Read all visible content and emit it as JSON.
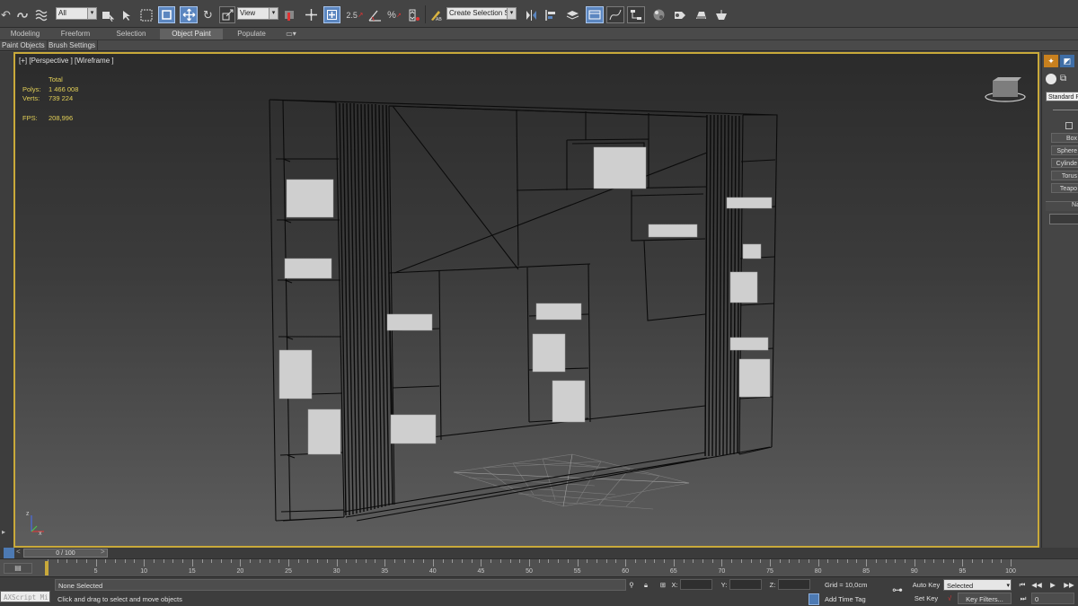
{
  "toolbar": {
    "selection_filter": "All",
    "ref_coord_system": "View",
    "named_selection": "Create Selection Se",
    "snap_angle_label": "2.5",
    "icons": [
      "undo-icon",
      "redo-icon",
      "link-icon",
      "unlink-icon",
      "bind-spacewarp-icon",
      "select-object-icon",
      "select-by-name-icon",
      "rect-selection-icon",
      "window-crossing-icon",
      "select-move-icon",
      "select-rotate-icon",
      "select-scale-icon",
      "pivot-icon",
      "manipulate-icon",
      "snap-toggle-icon",
      "angle-snap-icon",
      "percent-snap-icon",
      "spinner-snap-icon",
      "edit-named-selection-icon",
      "mirror-icon",
      "align-icon",
      "layer-explorer-icon",
      "scene-explorer-icon",
      "curve-editor-icon",
      "schematic-view-icon",
      "material-editor-icon",
      "render-setup-icon",
      "rendered-frame-icon",
      "render-icon"
    ]
  },
  "ribbon": {
    "tabs": [
      "Modeling",
      "Freeform",
      "Selection",
      "Object Paint",
      "Populate"
    ],
    "active_tab": "Object Paint",
    "sub_items": [
      "Paint Objects",
      "Brush Settings"
    ]
  },
  "viewport": {
    "label": "[+] [Perspective ] [Wireframe ]",
    "stats": {
      "total_label": "Total",
      "polys_label": "Polys:",
      "polys_value": "1 466 008",
      "verts_label": "Verts:",
      "verts_value": "739 224",
      "fps_label": "FPS:",
      "fps_value": "208,996"
    }
  },
  "command_panel": {
    "dropdown": "Standard P",
    "buttons": [
      "Box",
      "Sphere",
      "Cylinde",
      "Torus",
      "Teapo"
    ],
    "name_label": "Na"
  },
  "timeline": {
    "slider_label": "0 / 100",
    "ticks": [
      5,
      10,
      15,
      20,
      25,
      30,
      35,
      40,
      45,
      50,
      55,
      60,
      65,
      70,
      75,
      80,
      85,
      90,
      95,
      100
    ],
    "max_frame": 100
  },
  "status": {
    "maxscript_label": "AXScript Mi",
    "selection_text": "None Selected",
    "prompt_text": "Click and drag to select and move objects",
    "x_label": "X:",
    "y_label": "Y:",
    "z_label": "Z:",
    "grid_text": "Grid = 10,0cm",
    "add_time_tag": "Add Time Tag",
    "auto_key": "Auto Key",
    "set_key": "Set Key",
    "key_mode": "Selected",
    "key_filters": "Key Filters...",
    "frame_value": "0"
  },
  "colors": {
    "viewport_border": "#c9a93a",
    "stats_text": "#e2cf57",
    "active_button": "#5b86c0",
    "wire": "#0a0a0a",
    "books": "#cfcfcf"
  }
}
